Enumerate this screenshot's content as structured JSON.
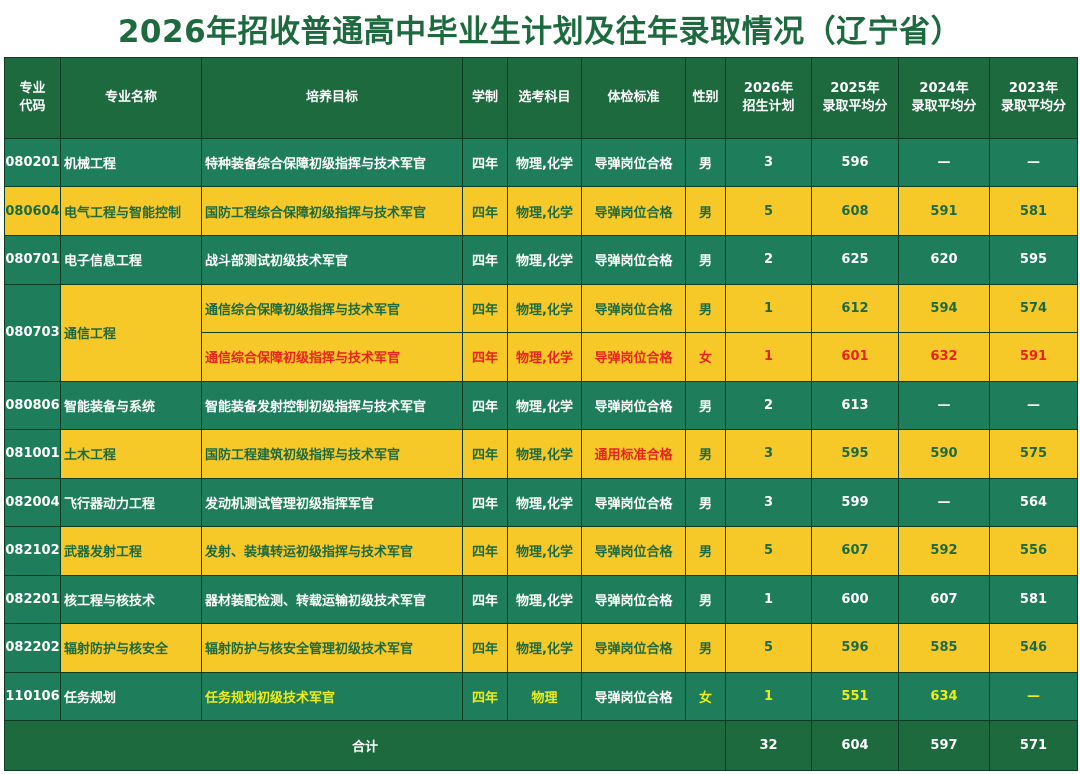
{
  "title": "2026年招收普通高中毕业生计划及往年录取情况（辽宁省）",
  "headers": {
    "code": "专业\n代码",
    "name": "专业名称",
    "goal": "培养目标",
    "years": "学制",
    "subjects": "选考科目",
    "physical": "体检标准",
    "gender": "性别",
    "plan2026": "2026年\n招生计划",
    "avg2025": "2025年\n录取平均分",
    "avg2024": "2024年\n录取平均分",
    "avg2023": "2023年\n录取平均分"
  },
  "rows": [
    {
      "code": "080201",
      "name": "机械工程",
      "goal": "特种装备综合保障初级指挥与技术军官",
      "years": "四年",
      "subjects": "物理,化学",
      "physical": "导弹岗位合格",
      "gender": "男",
      "plan": "3",
      "s2025": "596",
      "s2024": "—",
      "s2023": "—"
    },
    {
      "code": "080604",
      "name": "电气工程与智能控制",
      "goal": "国防工程综合保障初级指挥与技术军官",
      "years": "四年",
      "subjects": "物理,化学",
      "physical": "导弹岗位合格",
      "gender": "男",
      "plan": "5",
      "s2025": "608",
      "s2024": "591",
      "s2023": "581"
    },
    {
      "code": "080701",
      "name": "电子信息工程",
      "goal": "战斗部测试初级技术军官",
      "years": "四年",
      "subjects": "物理,化学",
      "physical": "导弹岗位合格",
      "gender": "男",
      "plan": "2",
      "s2025": "625",
      "s2024": "620",
      "s2023": "595"
    },
    {
      "code": "080703",
      "name": "通信工程",
      "goal": "通信综合保障初级指挥与技术军官",
      "years": "四年",
      "subjects": "物理,化学",
      "physical": "导弹岗位合格",
      "gender": "男",
      "plan": "1",
      "s2025": "612",
      "s2024": "594",
      "s2023": "574"
    },
    {
      "goal": "通信综合保障初级指挥与技术军官",
      "years": "四年",
      "subjects": "物理,化学",
      "physical": "导弹岗位合格",
      "gender": "女",
      "plan": "1",
      "s2025": "601",
      "s2024": "632",
      "s2023": "591"
    },
    {
      "code": "080806",
      "name": "智能装备与系统",
      "goal": "智能装备发射控制初级指挥与技术军官",
      "years": "四年",
      "subjects": "物理,化学",
      "physical": "导弹岗位合格",
      "gender": "男",
      "plan": "2",
      "s2025": "613",
      "s2024": "—",
      "s2023": "—"
    },
    {
      "code": "081001",
      "name": "土木工程",
      "goal": "国防工程建筑初级指挥与技术军官",
      "years": "四年",
      "subjects": "物理,化学",
      "physical": "通用标准合格",
      "gender": "男",
      "plan": "3",
      "s2025": "595",
      "s2024": "590",
      "s2023": "575"
    },
    {
      "code": "082004",
      "name": "飞行器动力工程",
      "goal": "发动机测试管理初级指挥军官",
      "years": "四年",
      "subjects": "物理,化学",
      "physical": "导弹岗位合格",
      "gender": "男",
      "plan": "3",
      "s2025": "599",
      "s2024": "—",
      "s2023": "564"
    },
    {
      "code": "082102",
      "name": "武器发射工程",
      "goal": "发射、装填转运初级指挥与技术军官",
      "years": "四年",
      "subjects": "物理,化学",
      "physical": "导弹岗位合格",
      "gender": "男",
      "plan": "5",
      "s2025": "607",
      "s2024": "592",
      "s2023": "556"
    },
    {
      "code": "082201",
      "name": "核工程与核技术",
      "goal": "器材装配检测、转载运输初级技术军官",
      "years": "四年",
      "subjects": "物理,化学",
      "physical": "导弹岗位合格",
      "gender": "男",
      "plan": "1",
      "s2025": "600",
      "s2024": "607",
      "s2023": "581"
    },
    {
      "code": "082202",
      "name": "辐射防护与核安全",
      "goal": "辐射防护与核安全管理初级技术军官",
      "years": "四年",
      "subjects": "物理,化学",
      "physical": "导弹岗位合格",
      "gender": "男",
      "plan": "5",
      "s2025": "596",
      "s2024": "585",
      "s2023": "546"
    },
    {
      "code": "110106",
      "name": "任务规划",
      "goal": "任务规划初级技术军官",
      "years": "四年",
      "subjects": "物理",
      "physical": "导弹岗位合格",
      "gender": "女",
      "plan": "1",
      "s2025": "551",
      "s2024": "634",
      "s2023": "—"
    }
  ],
  "total": {
    "label": "合计",
    "plan": "32",
    "s2025": "604",
    "s2024": "597",
    "s2023": "571"
  },
  "colors": {
    "dark_green": "#1e6a3f",
    "row_green": "#1e7d5a",
    "row_yellow": "#f7c928",
    "red_text": "#e8231c",
    "lime_text": "#ecec1c"
  }
}
